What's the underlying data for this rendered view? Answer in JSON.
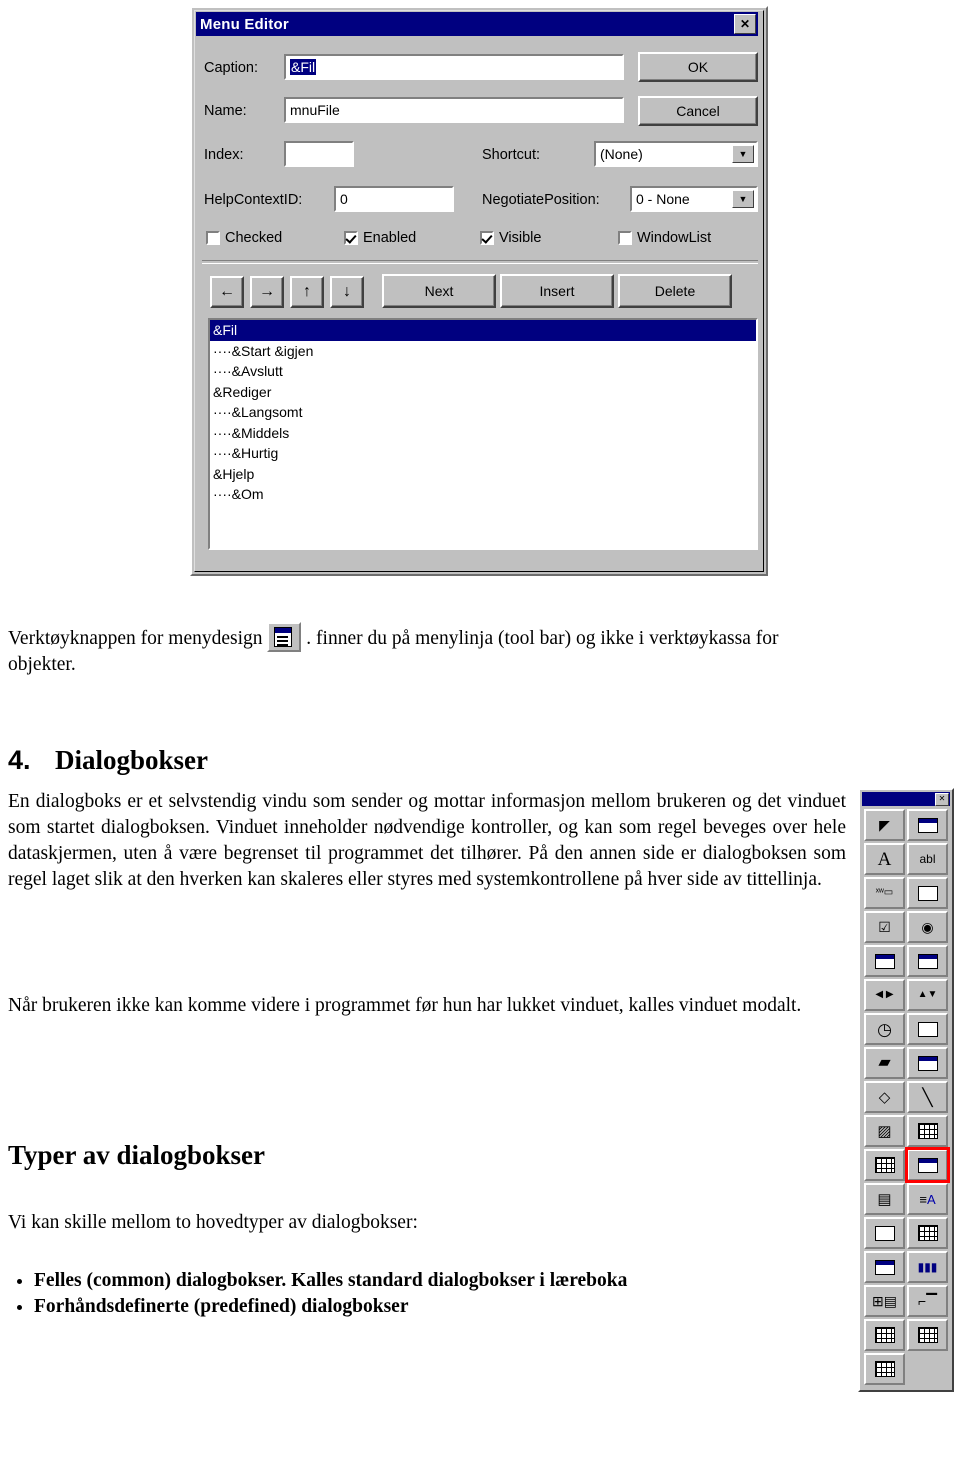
{
  "dialog": {
    "title": "Menu Editor",
    "close_label": "✕",
    "fields": {
      "caption_label": "Caption:",
      "caption_value": "&Fil",
      "name_label": "Name:",
      "name_value": "mnuFile",
      "index_label": "Index:",
      "index_value": "",
      "shortcut_label": "Shortcut:",
      "shortcut_value": "(None)",
      "helpcontext_label": "HelpContextID:",
      "helpcontext_value": "0",
      "negotiate_label": "NegotiatePosition:",
      "negotiate_value": "0 - None"
    },
    "checkboxes": [
      {
        "label": "Checked",
        "checked": false
      },
      {
        "label": "Enabled",
        "checked": true
      },
      {
        "label": "Visible",
        "checked": true
      },
      {
        "label": "WindowList",
        "checked": false
      }
    ],
    "buttons": {
      "ok": "OK",
      "cancel": "Cancel",
      "next": "Next",
      "insert": "Insert",
      "delete": "Delete",
      "arrow_left": "←",
      "arrow_right": "→",
      "arrow_up": "↑",
      "arrow_down": "↓"
    },
    "menu_items": [
      {
        "text": "&Fil",
        "selected": true
      },
      {
        "text": "····&Start &igjen",
        "selected": false
      },
      {
        "text": "····&Avslutt",
        "selected": false
      },
      {
        "text": "&Rediger",
        "selected": false
      },
      {
        "text": "····&Langsomt",
        "selected": false
      },
      {
        "text": "····&Middels",
        "selected": false
      },
      {
        "text": "····&Hurtig",
        "selected": false
      },
      {
        "text": "&Hjelp",
        "selected": false
      },
      {
        "text": "····&Om",
        "selected": false
      }
    ]
  },
  "body": {
    "caption_before": "Verktøyknappen for menydesign",
    "caption_after": ". finner du på menylinja (tool bar) og ikke i verktøykassa for objekter.",
    "section_number": "4.",
    "section_title": "Dialogbokser",
    "paragraph1": "En dialogboks er et selvstendig vindu som sender og mottar informasjon mellom brukeren og det vinduet som startet dialogboksen. Vinduet inneholder nødvendige kontroller, og kan som regel beveges over hele dataskjermen, uten å være begrenset til programmet det tilhører. På den annen side er dialogboksen som regel laget slik at den hverken kan skaleres eller styres med systemkontrollene på hver side av tittellinja.",
    "paragraph2": "Når brukeren ikke kan komme videre i programmet før hun har lukket vinduet, kalles vinduet modalt.",
    "heading2": "Typer av dialogbokser",
    "paragraph3": "Vi kan skille mellom to hovedtyper av dialogbokser:",
    "bullets": [
      "Felles (common) dialogbokser. Kalles standard dialogbokser i læreboka",
      "Forhåndsdefinerte (predefined) dialogbokser"
    ]
  },
  "toolbox": {
    "close_label": "✕",
    "tools": [
      {
        "name": "pointer-tool",
        "glyph": "◤"
      },
      {
        "name": "picture-box-tool",
        "glyph": "▣"
      },
      {
        "name": "label-tool",
        "glyph": "A"
      },
      {
        "name": "textbox-tool",
        "glyph": "abl"
      },
      {
        "name": "frame-tool",
        "glyph": "xw"
      },
      {
        "name": "command-button-tool",
        "glyph": "▭"
      },
      {
        "name": "check-box-tool",
        "glyph": "☑"
      },
      {
        "name": "option-button-tool",
        "glyph": "◉"
      },
      {
        "name": "combo-box-tool",
        "glyph": "▤"
      },
      {
        "name": "list-box-tool",
        "glyph": "▤"
      },
      {
        "name": "hscroll-bar-tool",
        "glyph": "◄►"
      },
      {
        "name": "vscroll-bar-tool",
        "glyph": "▲▼"
      },
      {
        "name": "timer-tool",
        "glyph": "◷"
      },
      {
        "name": "drive-list-box-tool",
        "glyph": "▭"
      },
      {
        "name": "dir-list-box-tool",
        "glyph": "▰"
      },
      {
        "name": "file-list-box-tool",
        "glyph": "▤"
      },
      {
        "name": "shape-tool",
        "glyph": "◇"
      },
      {
        "name": "line-tool",
        "glyph": "╲"
      },
      {
        "name": "image-tool",
        "glyph": "▨"
      },
      {
        "name": "data-tool",
        "glyph": "▥"
      },
      {
        "name": "ole-tool",
        "glyph": "▦"
      },
      {
        "name": "common-dialog-tool",
        "glyph": "▢",
        "highlight": true
      },
      {
        "name": "grid-control-tool",
        "glyph": "▤"
      },
      {
        "name": "rich-textbox-tool",
        "glyph": "A"
      },
      {
        "name": "picture-clip-tool",
        "glyph": "▢"
      },
      {
        "name": "masked-edit-tool",
        "glyph": "▤"
      },
      {
        "name": "panel-tool",
        "glyph": "▤"
      },
      {
        "name": "progress-bar-tool",
        "glyph": "▮▮"
      },
      {
        "name": "outline-tool",
        "glyph": "▤"
      },
      {
        "name": "tree-view-tool",
        "glyph": "⌐"
      },
      {
        "name": "list-view-tool",
        "glyph": "▩"
      },
      {
        "name": "toolbar-tool",
        "glyph": "▤"
      },
      {
        "name": "db-grid-tool",
        "glyph": "▦"
      },
      {
        "name": "db-list-tool",
        "glyph": "▥"
      },
      {
        "name": "calendar-tool",
        "glyph": "▦"
      }
    ]
  }
}
